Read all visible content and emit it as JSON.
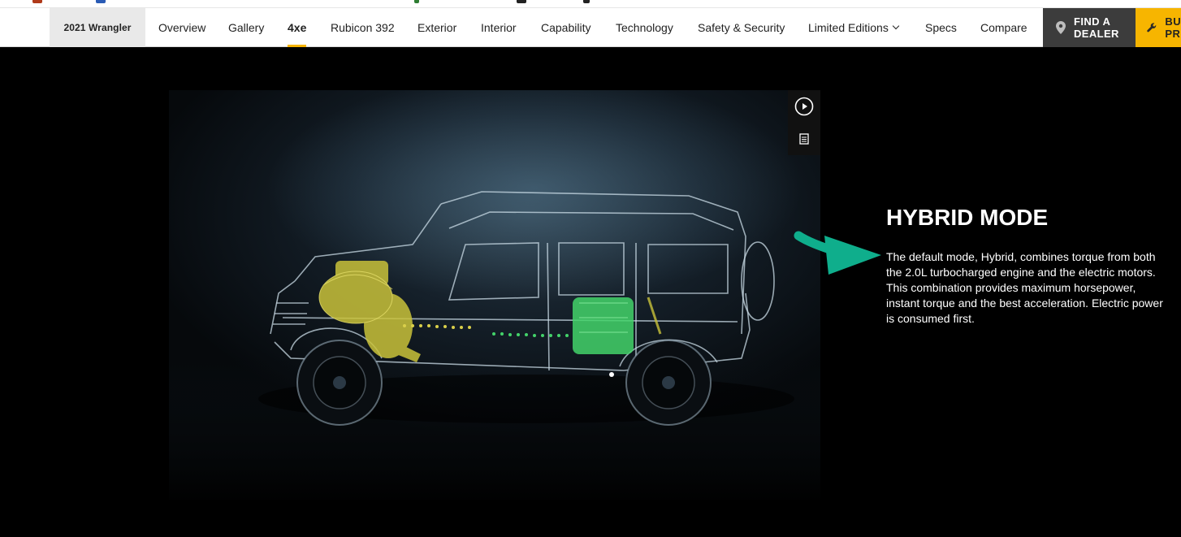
{
  "nav": {
    "model": "2021 Wrangler",
    "items": [
      {
        "label": "Overview"
      },
      {
        "label": "Gallery"
      },
      {
        "label": "4xe"
      },
      {
        "label": "Rubicon 392"
      },
      {
        "label": "Exterior"
      },
      {
        "label": "Interior"
      },
      {
        "label": "Capability"
      },
      {
        "label": "Technology"
      },
      {
        "label": "Safety & Security"
      },
      {
        "label": "Limited Editions"
      },
      {
        "label": "Specs"
      },
      {
        "label": "Compare"
      }
    ],
    "active": "4xe",
    "dealer_line1": "FIND A",
    "dealer_line2": "DEALER",
    "build_line1": "BU",
    "build_line2": "PR",
    "accent_color": "#f7b500"
  },
  "media": {
    "controls": [
      "play-icon",
      "transcript-icon"
    ]
  },
  "content": {
    "heading": "HYBRID MODE",
    "body": "The default mode, Hybrid, combines torque from both the 2.0L turbocharged engine and the electric motors. This combination provides maximum horsepower, instant torque and the best acceleration. Electric power is consumed first.",
    "arrow_color": "#0fae8c"
  }
}
